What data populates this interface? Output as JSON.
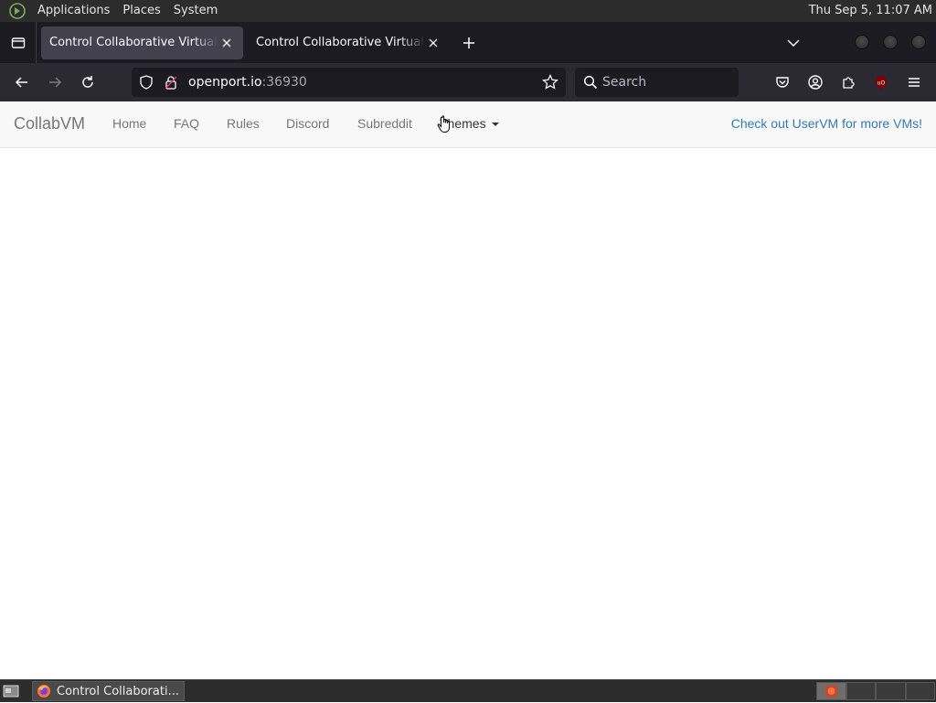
{
  "top_panel": {
    "menus": [
      "Applications",
      "Places",
      "System"
    ],
    "clock": "Thu Sep  5, 11:07 AM"
  },
  "tabs": [
    {
      "title": "Control Collaborative Virtual Machines",
      "active": true
    },
    {
      "title": "Control Collaborative Virtual Machines",
      "active": false
    }
  ],
  "navbar": {
    "url_host": "openport.io",
    "url_port": ":36930",
    "search_placeholder": "Search"
  },
  "site": {
    "brand": "CollabVM",
    "links": [
      "Home",
      "FAQ",
      "Rules",
      "Discord",
      "Subreddit"
    ],
    "themes_label": "Themes",
    "uservm_label": "Check out UserVM for more VMs!"
  },
  "taskbar": {
    "window_label": "Control Collaborati..."
  },
  "colors": {
    "accent_link": "#337ab7",
    "nav_text": "#777777",
    "panel_bg": "#2c2c2c",
    "browser_bg": "#2b2a33"
  }
}
